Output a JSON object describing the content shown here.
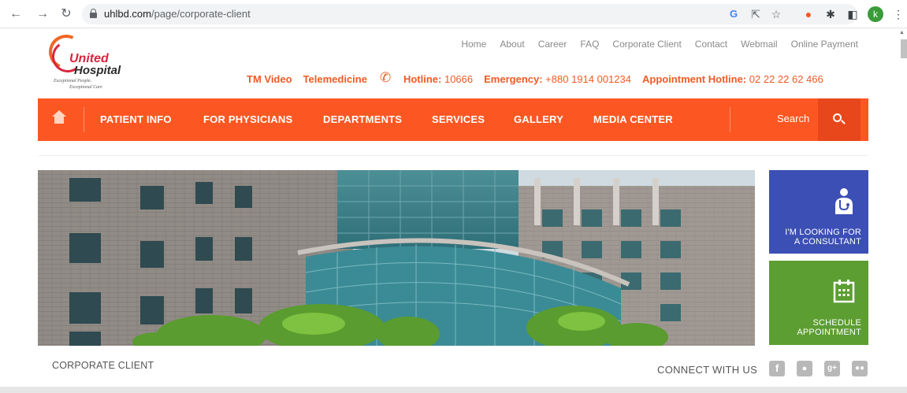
{
  "browser": {
    "url_host": "uhlbd.com",
    "url_path": "/page/corporate-client",
    "profile_initial": "k"
  },
  "logo": {
    "united": "United",
    "hospital": "Hospital",
    "tagline_1": "Exceptional People.",
    "tagline_2": "Exceptional Care"
  },
  "toplinks": [
    "Home",
    "About",
    "Career",
    "FAQ",
    "Corporate Client",
    "Contact",
    "Webmail",
    "Online Payment"
  ],
  "infobar": {
    "tm_video": "TM Video",
    "telemedicine": "Telemedicine",
    "hotline_label": "Hotline:",
    "hotline_value": "10666",
    "emergency_label": "Emergency:",
    "emergency_value": "+880 1914 001234",
    "appointment_label": "Appointment Hotline:",
    "appointment_value": "02 22 22 62 466"
  },
  "mainnav": {
    "items": [
      "PATIENT INFO",
      "FOR PHYSICIANS",
      "DEPARTMENTS",
      "SERVICES",
      "GALLERY",
      "MEDIA CENTER"
    ],
    "search_label": "Search"
  },
  "side": {
    "consult_line1": "I'M LOOKING FOR",
    "consult_line2": "A CONSULTANT",
    "schedule_line1": "SCHEDULE",
    "schedule_line2": "APPOINTMENT"
  },
  "bottom": {
    "page_label": "CORPORATE CLIENT",
    "connect": "CONNECT WITH US"
  },
  "colors": {
    "brand_orange": "#fc5722",
    "consult_blue": "#3c4fb4",
    "schedule_green": "#5c9e31"
  }
}
